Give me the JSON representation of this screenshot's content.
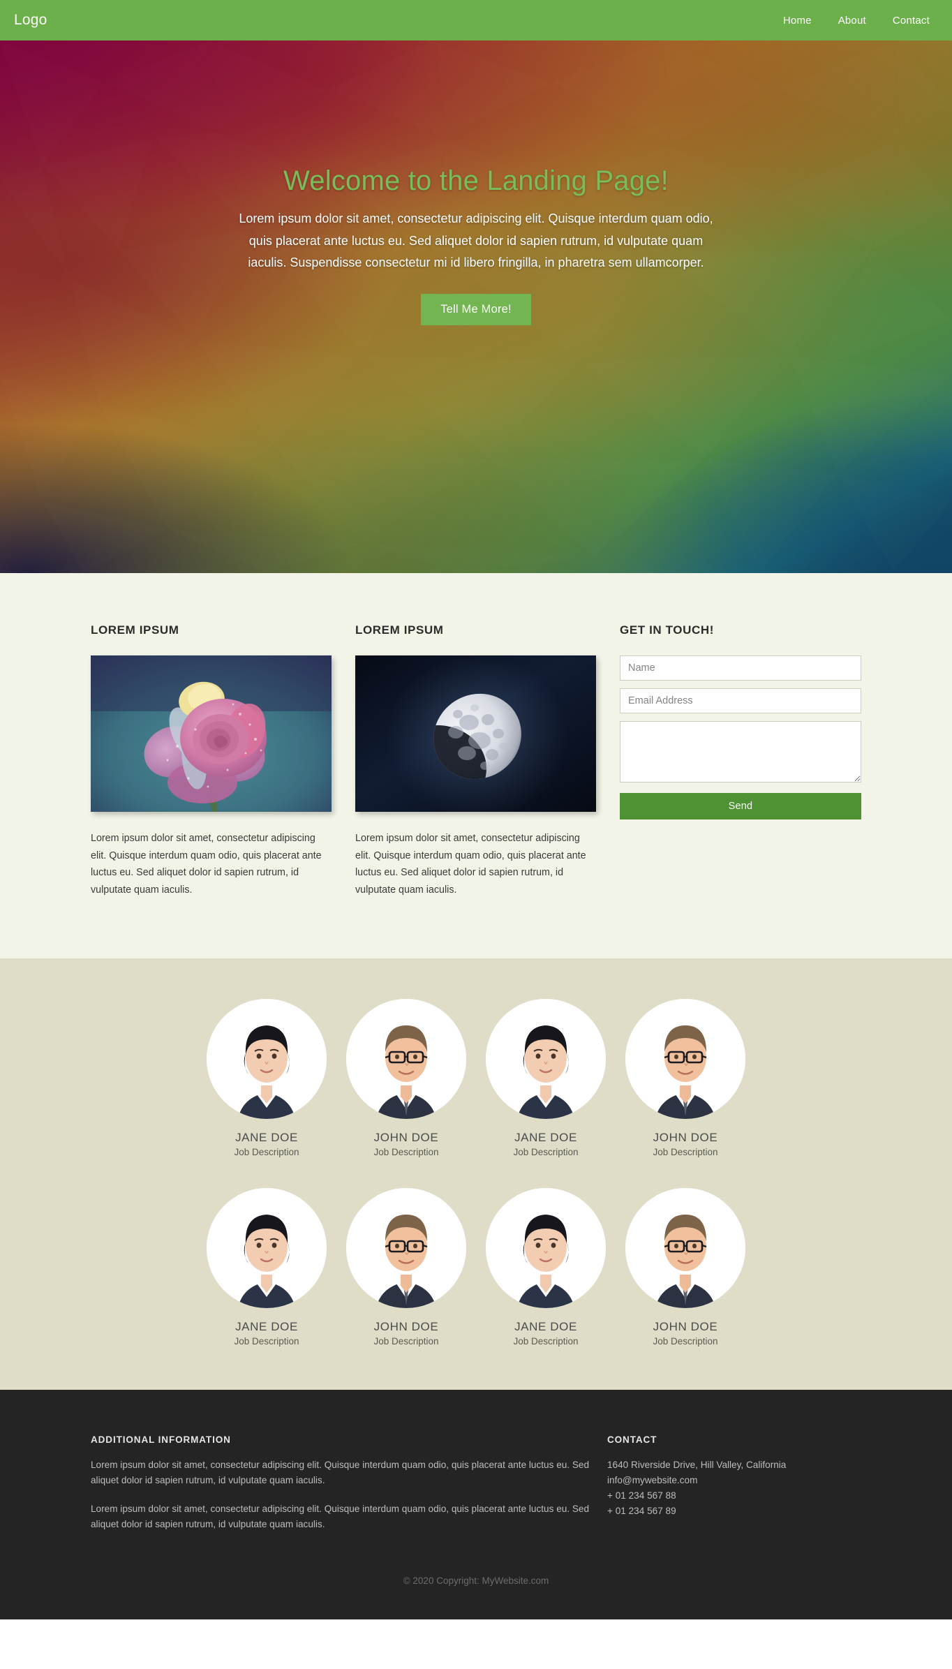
{
  "navbar": {
    "logo": "Logo",
    "links": [
      {
        "label": "Home"
      },
      {
        "label": "About"
      },
      {
        "label": "Contact"
      }
    ]
  },
  "hero": {
    "title": "Welcome to the Landing Page!",
    "paragraph": "Lorem ipsum dolor sit amet, consectetur adipiscing elit. Quisque interdum quam odio, quis placerat ante luctus eu. Sed aliquet dolor id sapien rutrum, id vulputate quam iaculis. Suspendisse consectetur mi id libero fringilla, in pharetra sem ullamcorper.",
    "button_label": "Tell Me More!",
    "title_color": "#79bd5b",
    "button_color": "#72b551"
  },
  "content": {
    "columns": [
      {
        "heading": "LOREM IPSUM",
        "image_name": "rose-flower-photo",
        "body": "Lorem ipsum dolor sit amet, consectetur adipiscing elit. Quisque interdum quam odio, quis placerat ante luctus eu. Sed aliquet dolor id sapien rutrum, id vulputate quam iaculis."
      },
      {
        "heading": "LOREM IPSUM",
        "image_name": "moon-photo",
        "body": "Lorem ipsum dolor sit amet, consectetur adipiscing elit. Quisque interdum quam odio, quis placerat ante luctus eu. Sed aliquet dolor id sapien rutrum, id vulputate quam iaculis."
      }
    ],
    "form": {
      "heading": "GET IN TOUCH!",
      "name_placeholder": "Name",
      "name_value": "",
      "email_placeholder": "Email Address",
      "email_value": "",
      "message_placeholder": "",
      "message_value": "",
      "send_label": "Send",
      "send_color": "#4e9234"
    },
    "background_color": "#f2f4e7"
  },
  "team": {
    "background_color": "#dfddc7",
    "members": [
      {
        "name": "JANE DOE",
        "role": "Job Description",
        "avatar": "woman-dark-hair-avatar"
      },
      {
        "name": "JOHN DOE",
        "role": "Job Description",
        "avatar": "man-glasses-avatar"
      },
      {
        "name": "JANE DOE",
        "role": "Job Description",
        "avatar": "woman-dark-hair-avatar"
      },
      {
        "name": "JOHN DOE",
        "role": "Job Description",
        "avatar": "man-glasses-avatar"
      },
      {
        "name": "JANE DOE",
        "role": "Job Description",
        "avatar": "woman-dark-hair-avatar"
      },
      {
        "name": "JOHN DOE",
        "role": "Job Description",
        "avatar": "man-glasses-avatar"
      },
      {
        "name": "JANE DOE",
        "role": "Job Description",
        "avatar": "woman-dark-hair-avatar"
      },
      {
        "name": "JOHN DOE",
        "role": "Job Description",
        "avatar": "man-glasses-avatar"
      }
    ]
  },
  "footer": {
    "background_color": "#242424",
    "additional": {
      "heading": "ADDITIONAL INFORMATION",
      "paragraph1": "Lorem ipsum dolor sit amet, consectetur adipiscing elit. Quisque interdum quam odio, quis placerat ante luctus eu. Sed aliquet dolor id sapien rutrum, id vulputate quam iaculis.",
      "paragraph2": "Lorem ipsum dolor sit amet, consectetur adipiscing elit. Quisque interdum quam odio, quis placerat ante luctus eu. Sed aliquet dolor id sapien rutrum, id vulputate quam iaculis."
    },
    "contact": {
      "heading": "CONTACT",
      "address": "1640 Riverside Drive, Hill Valley, California",
      "email": "info@mywebsite.com",
      "phone1": "+ 01 234 567 88",
      "phone2": "+ 01 234 567 89"
    },
    "copyright": "© 2020 Copyright: MyWebsite.com"
  }
}
